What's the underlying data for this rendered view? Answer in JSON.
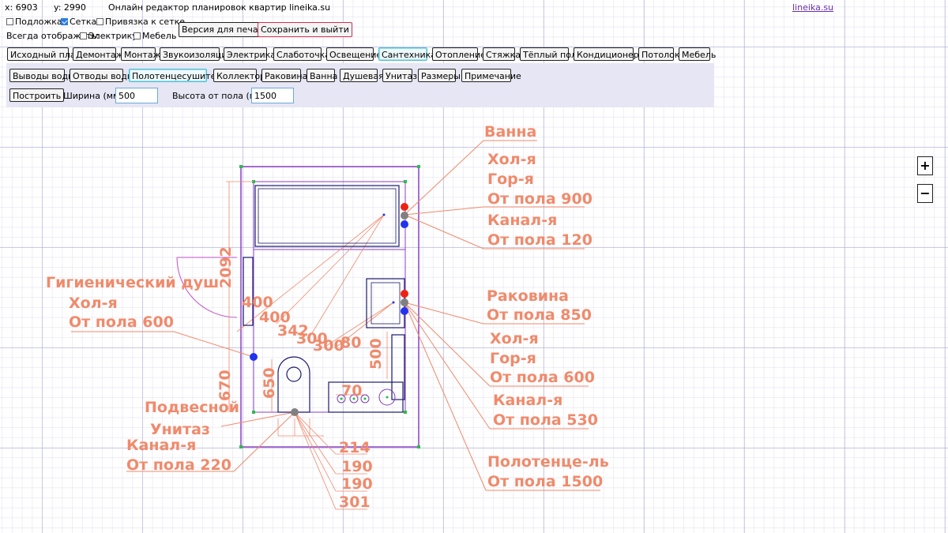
{
  "coords": {
    "x": "x: 6903",
    "y": "y: 2990"
  },
  "app_title": "Онлайн редактор планировок квартир lineika.su",
  "site_link": "lineika.su",
  "options": {
    "underlay": "Подложка",
    "grid": "Сетка",
    "snap": "Привязка к сетке",
    "always_show": "Всегда отображать:",
    "electric": "Электрику",
    "furniture": "Мебель"
  },
  "actions": {
    "print": "Версия для печати",
    "save_exit": "Сохранить и выйти"
  },
  "tabs": [
    "Исходный план",
    "Демонтаж",
    "Монтаж",
    "Звукоизоляция",
    "Электрика",
    "Слаботочка",
    "Освещение",
    "Сантехника",
    "Отопление",
    "Стяжка",
    "Тёплый пол",
    "Кондиционеры",
    "Потолок",
    "Мебель"
  ],
  "active_tab": "Сантехника",
  "subtabs": [
    "Выводы воды",
    "Отводы воды",
    "Полотенцесушитель",
    "Коллектор",
    "Раковина",
    "Ванна",
    "Душевая",
    "Унитаз",
    "Размеры",
    "Примечание"
  ],
  "active_subtab": "Полотенцесушитель",
  "form": {
    "build": "Построить",
    "width_label": "Ширина (мм):",
    "width_value": "500",
    "height_label": "Высота от пола (мм):",
    "height_value": "1500"
  },
  "zoom": {
    "plus": "+",
    "minus": "−"
  },
  "plan": {
    "dimensions": [
      "2092",
      "400",
      "400",
      "342",
      "300",
      "300",
      "80",
      "500",
      "670",
      "650",
      "70",
      "214",
      "190",
      "190",
      "301"
    ],
    "annotations": {
      "bath": [
        "Ванна",
        "Хол-я",
        "Гор-я",
        "От пола 900",
        "Канал-я",
        "От пола 120"
      ],
      "sink": [
        "Раковина",
        "От пола 850",
        "Хол-я",
        "Гор-я",
        "От пола 600",
        "Канал-я",
        "От пола 530"
      ],
      "towel": [
        "Полотенце-ль",
        "От пола 1500"
      ],
      "hygienic": [
        "Гигиенический душ",
        "Хол-я",
        "От пола 600"
      ],
      "toilet": [
        "Подвесной",
        "Унитаз",
        "Канал-я",
        "От пола 220"
      ]
    }
  },
  "colors": {
    "annotation": "#f08a6b",
    "wall": "#8b3fc4",
    "fixture": "#1a1a6e",
    "cold": "#2233ee",
    "hot": "#ee2211",
    "drain": "#808080"
  }
}
